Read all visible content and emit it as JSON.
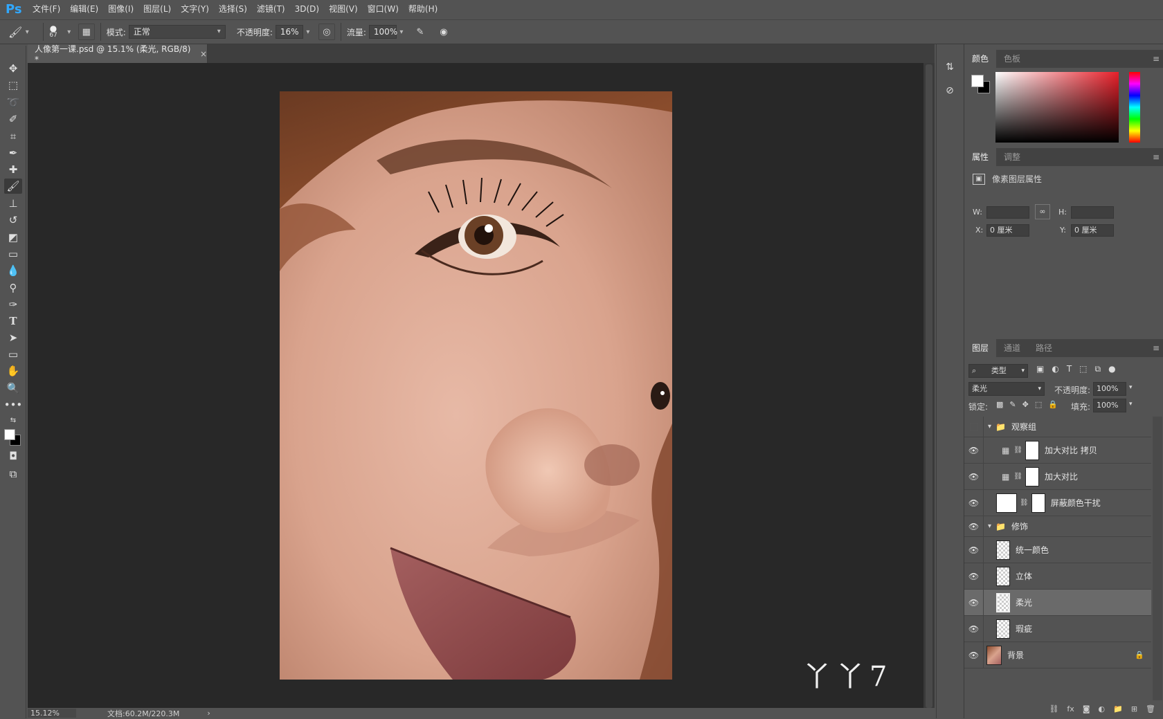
{
  "app": {
    "logo": "Ps"
  },
  "menu": [
    "文件(F)",
    "编辑(E)",
    "图像(I)",
    "图层(L)",
    "文字(Y)",
    "选择(S)",
    "滤镜(T)",
    "3D(D)",
    "视图(V)",
    "窗口(W)",
    "帮助(H)"
  ],
  "options": {
    "brush_size": "67",
    "mode_label": "模式:",
    "mode_value": "正常",
    "opacity_label": "不透明度:",
    "opacity_value": "16%",
    "flow_label": "流量:",
    "flow_value": "100%"
  },
  "document": {
    "tab_title": "人像第一课.psd @ 15.1% (柔光, RGB/8) *",
    "close": "×",
    "zoom": "15.12%",
    "doc_size": "文档:60.2M/220.3M",
    "arrow": "›",
    "watermark": "丫丫7"
  },
  "panels": {
    "color": {
      "tabs": [
        "颜色",
        "色板"
      ]
    },
    "properties": {
      "tabs": [
        "属性",
        "调整"
      ],
      "header": "像素图层属性",
      "w_label": "W:",
      "h_label": "H:",
      "x_label": "X:",
      "y_label": "Y:",
      "x_value": "0 厘米",
      "y_value": "0 厘米"
    },
    "layers": {
      "tabs": [
        "图层",
        "通道",
        "路径"
      ],
      "filter_kind": "类型",
      "blend_mode": "柔光",
      "opacity_label": "不透明度:",
      "opacity_value": "100%",
      "lock_label": "锁定:",
      "fill_label": "填充:",
      "fill_value": "100%",
      "items": [
        {
          "name": "观察组"
        },
        {
          "name": "加大对比 拷贝"
        },
        {
          "name": "加大对比"
        },
        {
          "name": "屏蔽颜色干扰"
        },
        {
          "name": "修饰"
        },
        {
          "name": "统一颜色"
        },
        {
          "name": "立体"
        },
        {
          "name": "柔光"
        },
        {
          "name": "瑕疵"
        },
        {
          "name": "背景"
        }
      ]
    }
  },
  "colors": {
    "accent": "#31a8ff",
    "panel_bg": "#535353",
    "canvas_bg": "#282828"
  }
}
